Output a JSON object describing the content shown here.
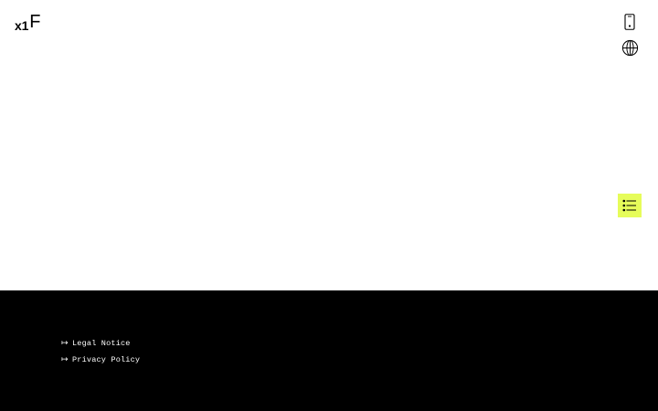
{
  "header": {
    "logo": {
      "prefix": "x1",
      "mark": "F"
    },
    "icons": {
      "device": "smartphone-icon",
      "language": "globe-icon"
    }
  },
  "floating": {
    "toc_icon": "list-icon",
    "accent_color": "#e6fc5a"
  },
  "footer": {
    "background": "#000000",
    "links": [
      {
        "arrow": "↦",
        "label": "Legal Notice"
      },
      {
        "arrow": "↦",
        "label": "Privacy Policy"
      }
    ]
  }
}
